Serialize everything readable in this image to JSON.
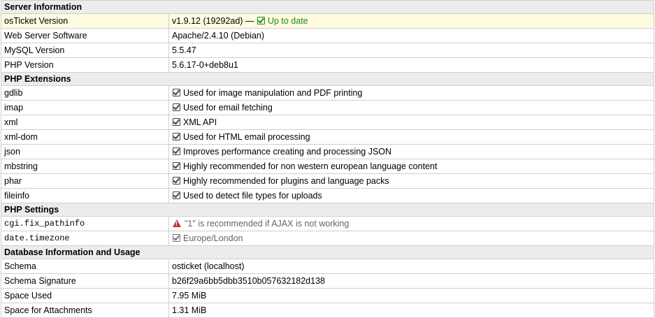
{
  "sections": {
    "server": {
      "title": "Server Information",
      "rows": [
        {
          "label": "osTicket Version",
          "value": "v1.9.12 (19292ad) —",
          "status": "Up to date"
        },
        {
          "label": "Web Server Software",
          "value": "Apache/2.4.10 (Debian)"
        },
        {
          "label": "MySQL Version",
          "value": "5.5.47"
        },
        {
          "label": "PHP Version",
          "value": "5.6.17-0+deb8u1"
        }
      ]
    },
    "extensions": {
      "title": "PHP Extensions",
      "rows": [
        {
          "label": "gdlib",
          "value": "Used for image manipulation and PDF printing"
        },
        {
          "label": "imap",
          "value": "Used for email fetching"
        },
        {
          "label": "xml",
          "value": "XML API"
        },
        {
          "label": "xml-dom",
          "value": "Used for HTML email processing"
        },
        {
          "label": "json",
          "value": "Improves performance creating and processing JSON"
        },
        {
          "label": "mbstring",
          "value": "Highly recommended for non western european language content"
        },
        {
          "label": "phar",
          "value": "Highly recommended for plugins and language packs"
        },
        {
          "label": "fileinfo",
          "value": "Used to detect file types for uploads"
        }
      ]
    },
    "settings": {
      "title": "PHP Settings",
      "rows": [
        {
          "label": "cgi.fix_pathinfo",
          "value": "\"1\" is recommended if AJAX is not working",
          "icon": "warning-icon"
        },
        {
          "label": "date.timezone",
          "value": "Europe/London",
          "icon": "check-square-icon"
        }
      ]
    },
    "database": {
      "title": "Database Information and Usage",
      "rows": [
        {
          "label": "Schema",
          "value": "osticket (localhost)"
        },
        {
          "label": "Schema Signature",
          "value": "b26f29a6bb5dbb3510b057632182d138"
        },
        {
          "label": "Space Used",
          "value": "7.95 MiB"
        },
        {
          "label": "Space for Attachments",
          "value": "1.31 MiB"
        }
      ]
    }
  },
  "colors": {
    "header_bg": "#ececec",
    "highlight_bg": "#fffbe0",
    "ok_green": "#1e8a1e",
    "warning_red": "#c9302c"
  }
}
